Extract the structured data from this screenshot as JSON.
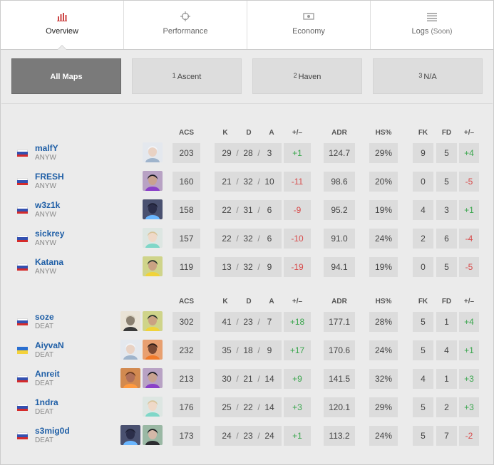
{
  "tabs": [
    {
      "label": "Overview",
      "icon": "bar-chart-icon",
      "active": true
    },
    {
      "label": "Performance",
      "icon": "crosshair-icon"
    },
    {
      "label": "Economy",
      "icon": "money-icon"
    },
    {
      "label": "Logs",
      "soon": "(Soon)",
      "icon": "list-icon"
    }
  ],
  "maps": [
    {
      "num": "",
      "label": "All Maps",
      "active": true
    },
    {
      "num": "1",
      "label": "Ascent"
    },
    {
      "num": "2",
      "label": "Haven"
    },
    {
      "num": "3",
      "label": "N/A"
    }
  ],
  "columns": {
    "acs": "ACS",
    "k": "K",
    "d": "D",
    "a": "A",
    "pm": "+/–",
    "adr": "ADR",
    "hs": "HS%",
    "fk": "FK",
    "fd": "FD",
    "fkfd": "+/–"
  },
  "teams": [
    {
      "players": [
        {
          "name": "malfY",
          "team": "ANYW",
          "flag": "ru",
          "agents": [
            "jett"
          ],
          "acs": "203",
          "k": "29",
          "d": "28",
          "a": "3",
          "pm": "+1",
          "adr": "124.7",
          "hs": "29%",
          "fk": "9",
          "fd": "5",
          "fkfd": "+4"
        },
        {
          "name": "FRESH",
          "team": "ANYW",
          "flag": "ru",
          "agents": [
            "reyna"
          ],
          "acs": "160",
          "k": "21",
          "d": "32",
          "a": "10",
          "pm": "-11",
          "adr": "98.6",
          "hs": "20%",
          "fk": "0",
          "fd": "5",
          "fkfd": "-5"
        },
        {
          "name": "w3z1k",
          "team": "ANYW",
          "flag": "ru",
          "agents": [
            "omen"
          ],
          "acs": "158",
          "k": "22",
          "d": "31",
          "a": "6",
          "pm": "-9",
          "adr": "95.2",
          "hs": "19%",
          "fk": "4",
          "fd": "3",
          "fkfd": "+1"
        },
        {
          "name": "sickrey",
          "team": "ANYW",
          "flag": "ru",
          "agents": [
            "sage"
          ],
          "acs": "157",
          "k": "22",
          "d": "32",
          "a": "6",
          "pm": "-10",
          "adr": "91.0",
          "hs": "24%",
          "fk": "2",
          "fd": "6",
          "fkfd": "-4"
        },
        {
          "name": "Katana",
          "team": "ANYW",
          "flag": "ru",
          "agents": [
            "killjoy"
          ],
          "acs": "119",
          "k": "13",
          "d": "32",
          "a": "9",
          "pm": "-19",
          "adr": "94.1",
          "hs": "19%",
          "fk": "0",
          "fd": "5",
          "fkfd": "-5"
        }
      ]
    },
    {
      "players": [
        {
          "name": "soze",
          "team": "DEAT",
          "flag": "ru",
          "agents": [
            "cypher",
            "killjoy"
          ],
          "acs": "302",
          "k": "41",
          "d": "23",
          "a": "7",
          "pm": "+18",
          "adr": "177.1",
          "hs": "28%",
          "fk": "5",
          "fd": "1",
          "fkfd": "+4"
        },
        {
          "name": "AiyvaN",
          "team": "DEAT",
          "flag": "ua",
          "agents": [
            "jett",
            "phoenix"
          ],
          "acs": "232",
          "k": "35",
          "d": "18",
          "a": "9",
          "pm": "+17",
          "adr": "170.6",
          "hs": "24%",
          "fk": "5",
          "fd": "4",
          "fkfd": "+1"
        },
        {
          "name": "Anreit",
          "team": "DEAT",
          "flag": "ru",
          "agents": [
            "breach",
            "reyna"
          ],
          "acs": "213",
          "k": "30",
          "d": "21",
          "a": "14",
          "pm": "+9",
          "adr": "141.5",
          "hs": "32%",
          "fk": "4",
          "fd": "1",
          "fkfd": "+3"
        },
        {
          "name": "1ndra",
          "team": "DEAT",
          "flag": "ru",
          "agents": [
            "sage"
          ],
          "acs": "176",
          "k": "25",
          "d": "22",
          "a": "14",
          "pm": "+3",
          "adr": "120.1",
          "hs": "29%",
          "fk": "5",
          "fd": "2",
          "fkfd": "+3"
        },
        {
          "name": "s3mig0d",
          "team": "DEAT",
          "flag": "ru",
          "agents": [
            "omen",
            "viper"
          ],
          "acs": "173",
          "k": "24",
          "d": "23",
          "a": "24",
          "pm": "+1",
          "adr": "113.2",
          "hs": "24%",
          "fk": "5",
          "fd": "7",
          "fkfd": "-2"
        }
      ]
    }
  ],
  "colors": {
    "positive": "#3aa64d",
    "negative": "#d84b4b",
    "player_name": "#1e5ea6",
    "active_map": "#7a7a7a"
  }
}
